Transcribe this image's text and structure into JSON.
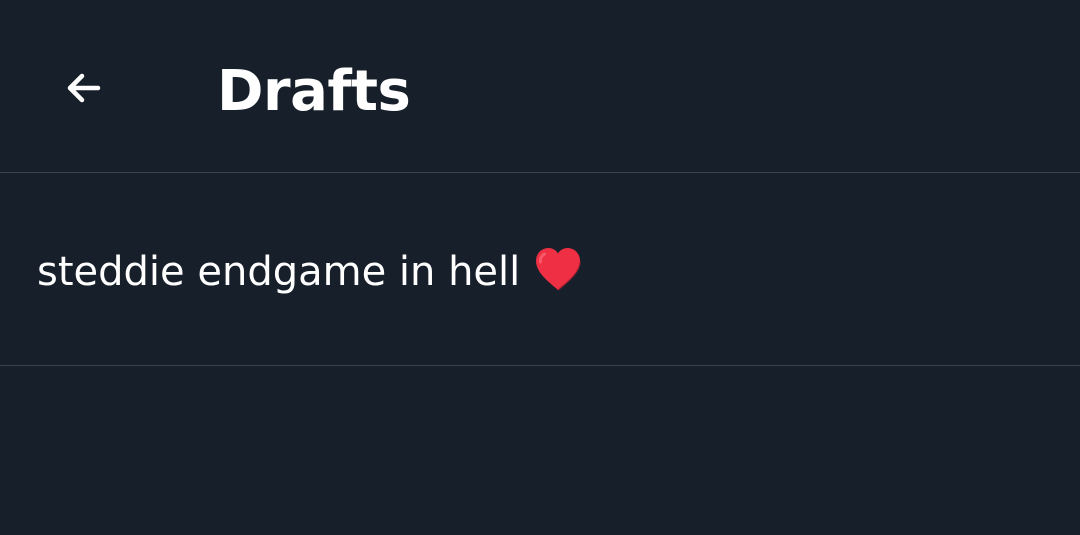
{
  "header": {
    "back_icon": "arrow-left-icon",
    "title": "Drafts"
  },
  "drafts": [
    {
      "text": "steddie endgame in hell",
      "emoji_icon": "red-heart-icon",
      "emoji_color": "#ef2f43"
    }
  ],
  "colors": {
    "background": "#17202a",
    "divider": "#38444d",
    "text": "#ffffff"
  }
}
